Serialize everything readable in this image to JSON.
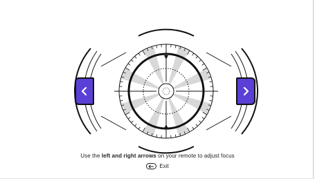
{
  "colors": {
    "accent": "#5b3fd6",
    "stroke": "#111111",
    "ray": "#d8d8d8"
  },
  "nav": {
    "left_icon": "chevron-left-icon",
    "right_icon": "chevron-right-icon"
  },
  "instruction": {
    "prefix": "Use the ",
    "bold": "left and right arrows",
    "suffix": " on your remote to adjust focus"
  },
  "exit": {
    "icon": "back-arrow-icon",
    "label": "Exit"
  }
}
